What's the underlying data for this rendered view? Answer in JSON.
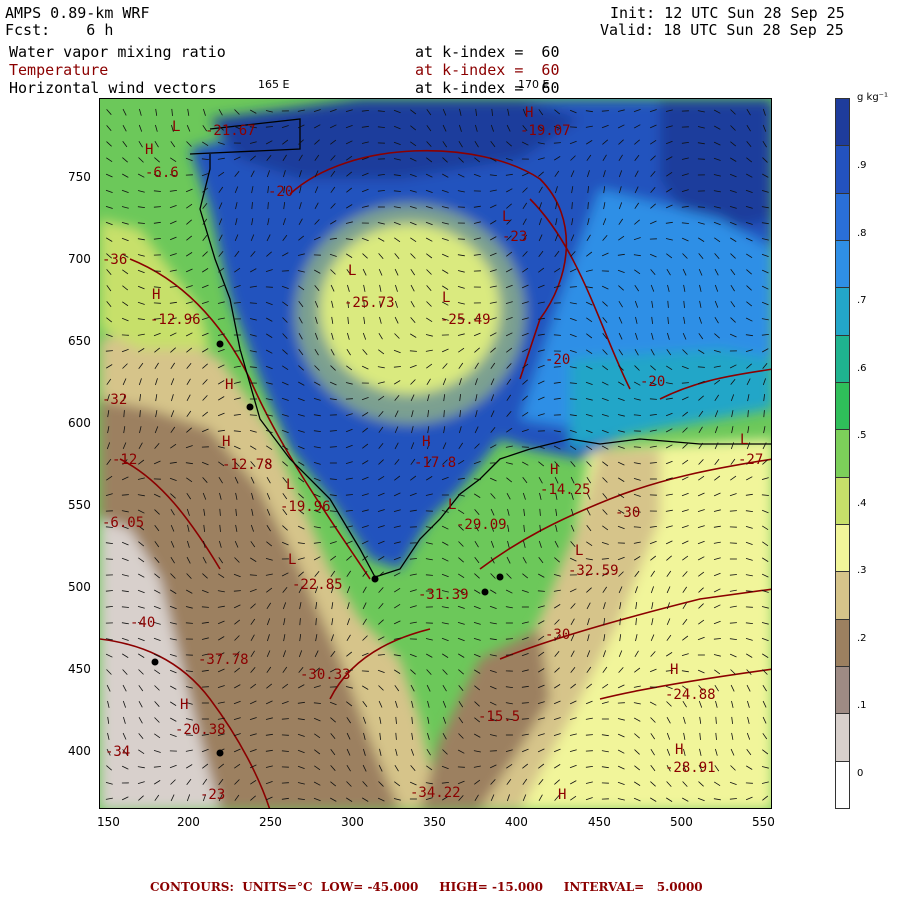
{
  "header": {
    "model": "AMPS 0.89-km WRF",
    "fcst": "Fcst:    6 h",
    "init": "Init: 12 UTC Sun 28 Sep 25",
    "valid": "Valid: 18 UTC Sun 28 Sep 25",
    "field1": "Water vapor mixing ratio",
    "field2": "Temperature",
    "field3": "Horizontal wind vectors",
    "level1": "at k-index =  60",
    "level2": "at k-index =  60",
    "level3": "at k-index =  60"
  },
  "lon_labels": [
    "165 E",
    "170 E"
  ],
  "x_ticks": [
    "150",
    "200",
    "250",
    "300",
    "350",
    "400",
    "450",
    "500",
    "550"
  ],
  "y_ticks": [
    "750",
    "700",
    "650",
    "600",
    "550",
    "500",
    "450",
    "400"
  ],
  "colorbar": {
    "unit": "g kg⁻¹",
    "labels": [
      ".9",
      ".8",
      ".7",
      ".6",
      ".5",
      ".4",
      ".3",
      ".2",
      ".1",
      "0"
    ],
    "colors": [
      "#1e3c9c",
      "#2352be",
      "#2a6fd8",
      "#2f8fe6",
      "#23a6c8",
      "#1fb38f",
      "#2fbe5a",
      "#7ccf5a",
      "#c7e06a",
      "#f1f59a",
      "#d6c48a",
      "#9c8060",
      "#9e8b84",
      "#d8d0cc",
      "#ffffff"
    ]
  },
  "map_labels": [
    {
      "t": "L",
      "k": "hl"
    },
    {
      "t": "-21.67",
      "k": "v"
    },
    {
      "t": "H",
      "k": "hl"
    },
    {
      "t": "-19.07",
      "k": "v"
    },
    {
      "t": "-20",
      "k": "v"
    },
    {
      "t": "L",
      "k": "hl"
    },
    {
      "t": "-23",
      "k": "v"
    },
    {
      "t": "L",
      "k": "hl"
    },
    {
      "t": "-25.73",
      "k": "v"
    },
    {
      "t": "L",
      "k": "hl"
    },
    {
      "t": "-25.49",
      "k": "v"
    },
    {
      "t": "-20",
      "k": "v"
    },
    {
      "t": "-20",
      "k": "v"
    },
    {
      "t": "H",
      "k": "hl"
    },
    {
      "t": "-12.96",
      "k": "v"
    },
    {
      "t": "-36",
      "k": "v"
    },
    {
      "t": "H",
      "k": "hl"
    },
    {
      "t": "-6.6",
      "k": "v"
    },
    {
      "t": "-32",
      "k": "v"
    },
    {
      "t": "H",
      "k": "hl"
    },
    {
      "t": "-12",
      "k": "v"
    },
    {
      "t": "H",
      "k": "hl"
    },
    {
      "t": "-12.78",
      "k": "v"
    },
    {
      "t": "H",
      "k": "hl"
    },
    {
      "t": "-17.8",
      "k": "v"
    },
    {
      "t": "H",
      "k": "hl"
    },
    {
      "t": "-14.25",
      "k": "v"
    },
    {
      "t": "L",
      "k": "hl"
    },
    {
      "t": "-27",
      "k": "v"
    },
    {
      "t": "-6.05",
      "k": "v"
    },
    {
      "t": "L",
      "k": "hl"
    },
    {
      "t": "-19.96",
      "k": "v"
    },
    {
      "t": "L",
      "k": "hl"
    },
    {
      "t": "-29.09",
      "k": "v"
    },
    {
      "t": "-30",
      "k": "v"
    },
    {
      "t": "L",
      "k": "hl"
    },
    {
      "t": "-32.59",
      "k": "v"
    },
    {
      "t": "L",
      "k": "hl"
    },
    {
      "t": "-22.85",
      "k": "v"
    },
    {
      "t": "-31.39",
      "k": "v"
    },
    {
      "t": "-40",
      "k": "v"
    },
    {
      "t": "-30",
      "k": "v"
    },
    {
      "t": "-37.78",
      "k": "v"
    },
    {
      "t": "-30.33",
      "k": "v"
    },
    {
      "t": "H",
      "k": "hl"
    },
    {
      "t": "-24.88",
      "k": "v"
    },
    {
      "t": "H",
      "k": "hl"
    },
    {
      "t": "-20.38",
      "k": "v"
    },
    {
      "t": "-34",
      "k": "v"
    },
    {
      "t": "-15.5",
      "k": "v"
    },
    {
      "t": "H",
      "k": "hl"
    },
    {
      "t": "-28.91",
      "k": "v"
    },
    {
      "t": "-23",
      "k": "v"
    },
    {
      "t": "-34.22",
      "k": "v"
    },
    {
      "t": "H",
      "k": "hl"
    }
  ],
  "footer": "CONTOURS:  UNITS=°C  LOW= -45.000     HIGH= -15.000     INTERVAL=   5.0000"
}
